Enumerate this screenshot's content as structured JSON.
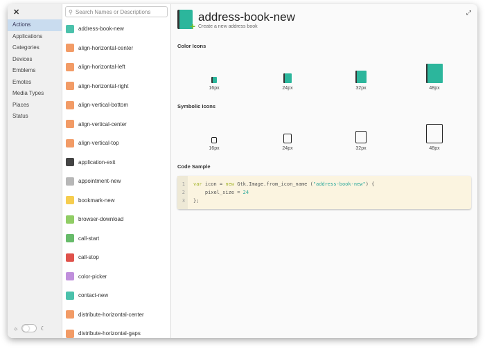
{
  "sidebar": {
    "close": "✕",
    "categories": [
      "Actions",
      "Applications",
      "Categories",
      "Devices",
      "Emblems",
      "Emotes",
      "Media Types",
      "Places",
      "Status"
    ],
    "selected": "Actions",
    "theme_light": "☼",
    "theme_dark": "☾"
  },
  "search": {
    "placeholder": "Search Names or Descriptions",
    "icon": "⚲"
  },
  "list": [
    {
      "name": "address-book-new",
      "color": "#2cb69c"
    },
    {
      "name": "align-horizontal-center",
      "color": "#f08a4b"
    },
    {
      "name": "align-horizontal-left",
      "color": "#f08a4b"
    },
    {
      "name": "align-horizontal-right",
      "color": "#f08a4b"
    },
    {
      "name": "align-vertical-bottom",
      "color": "#f08a4b"
    },
    {
      "name": "align-vertical-center",
      "color": "#f08a4b"
    },
    {
      "name": "align-vertical-top",
      "color": "#f08a4b"
    },
    {
      "name": "application-exit",
      "color": "#222"
    },
    {
      "name": "appointment-new",
      "color": "#aaa"
    },
    {
      "name": "bookmark-new",
      "color": "#f4c430"
    },
    {
      "name": "browser-download",
      "color": "#7cc44a"
    },
    {
      "name": "call-start",
      "color": "#4caf50"
    },
    {
      "name": "call-stop",
      "color": "#d9342b"
    },
    {
      "name": "color-picker",
      "color": "#b57bd6"
    },
    {
      "name": "contact-new",
      "color": "#2cb69c"
    },
    {
      "name": "distribute-horizontal-center",
      "color": "#f08a4b"
    },
    {
      "name": "distribute-horizontal-gaps",
      "color": "#f08a4b"
    }
  ],
  "detail": {
    "title": "address-book-new",
    "description": "Create a new address book",
    "expand": "⤢",
    "color_heading": "Color Icons",
    "symbolic_heading": "Symbolic Icons",
    "code_heading": "Code Sample",
    "sizes": [
      "16px",
      "24px",
      "32px",
      "48px"
    ],
    "code": {
      "lines": [
        "1",
        "2",
        "3"
      ],
      "var": "var",
      "l1a": " icon = ",
      "new": "new",
      "l1b": " Gtk.Image.from_icon_name (",
      "str": "\"address-book-new\"",
      "l1c": ") {",
      "l2a": "    pixel_size = ",
      "num": "24",
      "l3": "};"
    }
  }
}
